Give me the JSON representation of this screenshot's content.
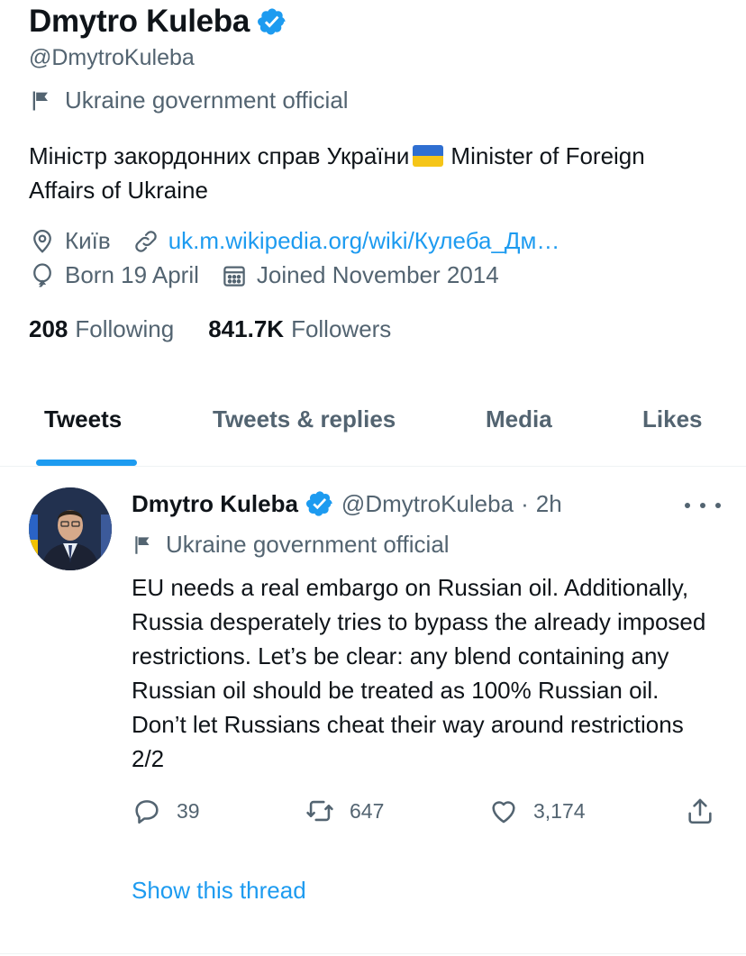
{
  "profile": {
    "name": "Dmytro Kuleba",
    "handle": "@DmytroKuleba",
    "label": "Ukraine government official",
    "bio_part1": "Міністр закордонних справ України",
    "bio_part2": "Minister of Foreign Affairs of Ukraine",
    "location": "Київ",
    "website": "uk.m.wikipedia.org/wiki/Кулеба_Дм…",
    "birthday": "Born 19 April",
    "joined": "Joined November 2014",
    "following_count": "208",
    "following_label": "Following",
    "followers_count": "841.7K",
    "followers_label": "Followers"
  },
  "tabs": [
    {
      "label": "Tweets",
      "active": true
    },
    {
      "label": "Tweets & replies",
      "active": false
    },
    {
      "label": "Media",
      "active": false
    },
    {
      "label": "Likes",
      "active": false
    }
  ],
  "tweet": {
    "author": "Dmytro Kuleba",
    "handle": "@DmytroKuleba",
    "separator": "·",
    "time": "2h",
    "label": "Ukraine government official",
    "text": "EU needs a real embargo on Russian oil. Additionally, Russia desperately tries to bypass the already imposed restrictions. Let’s be clear: any blend containing any Russian oil should be treated as 100% Russian oil. Don’t let Russians cheat their way around restrictions 2/2",
    "replies": "39",
    "retweets": "647",
    "likes": "3,174",
    "show_thread": "Show this thread"
  },
  "colors": {
    "accent": "#1d9bf0",
    "secondary_text": "#536471",
    "primary_text": "#0f1419",
    "flag_blue": "#2f6fd1",
    "flag_yellow": "#f5c518"
  },
  "icons": [
    "verified-badge-icon",
    "flag-icon",
    "location-icon",
    "link-icon",
    "balloon-icon",
    "calendar-icon",
    "more-icon",
    "reply-icon",
    "retweet-icon",
    "like-icon",
    "share-icon"
  ]
}
